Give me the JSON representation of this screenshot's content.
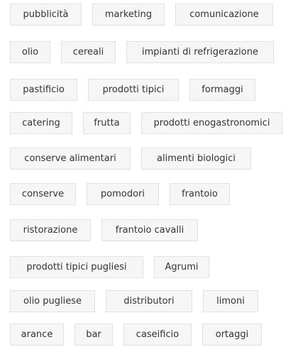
{
  "tags": {
    "row1": [
      "pubblicità",
      "marketing",
      "comunicazione"
    ],
    "row2": [
      "olio",
      "cereali",
      "impianti di refrigerazione"
    ],
    "row3": [
      "pastificio",
      "prodotti tipici",
      "formaggi"
    ],
    "row4": [
      "catering",
      "frutta",
      "prodotti enogastronomici"
    ],
    "row5": [
      "conserve alimentari",
      "alimenti biologici"
    ],
    "row6": [
      "conserve",
      "pomodori",
      "frantoio"
    ],
    "row7": [
      "ristorazione",
      "frantoio cavalli"
    ],
    "row8": [
      "prodotti tipici pugliesi",
      "Agrumi"
    ],
    "row9": [
      "olio pugliese",
      "distributori",
      "limoni"
    ],
    "row10": [
      "arance",
      "bar",
      "caseificio",
      "ortaggi"
    ]
  }
}
